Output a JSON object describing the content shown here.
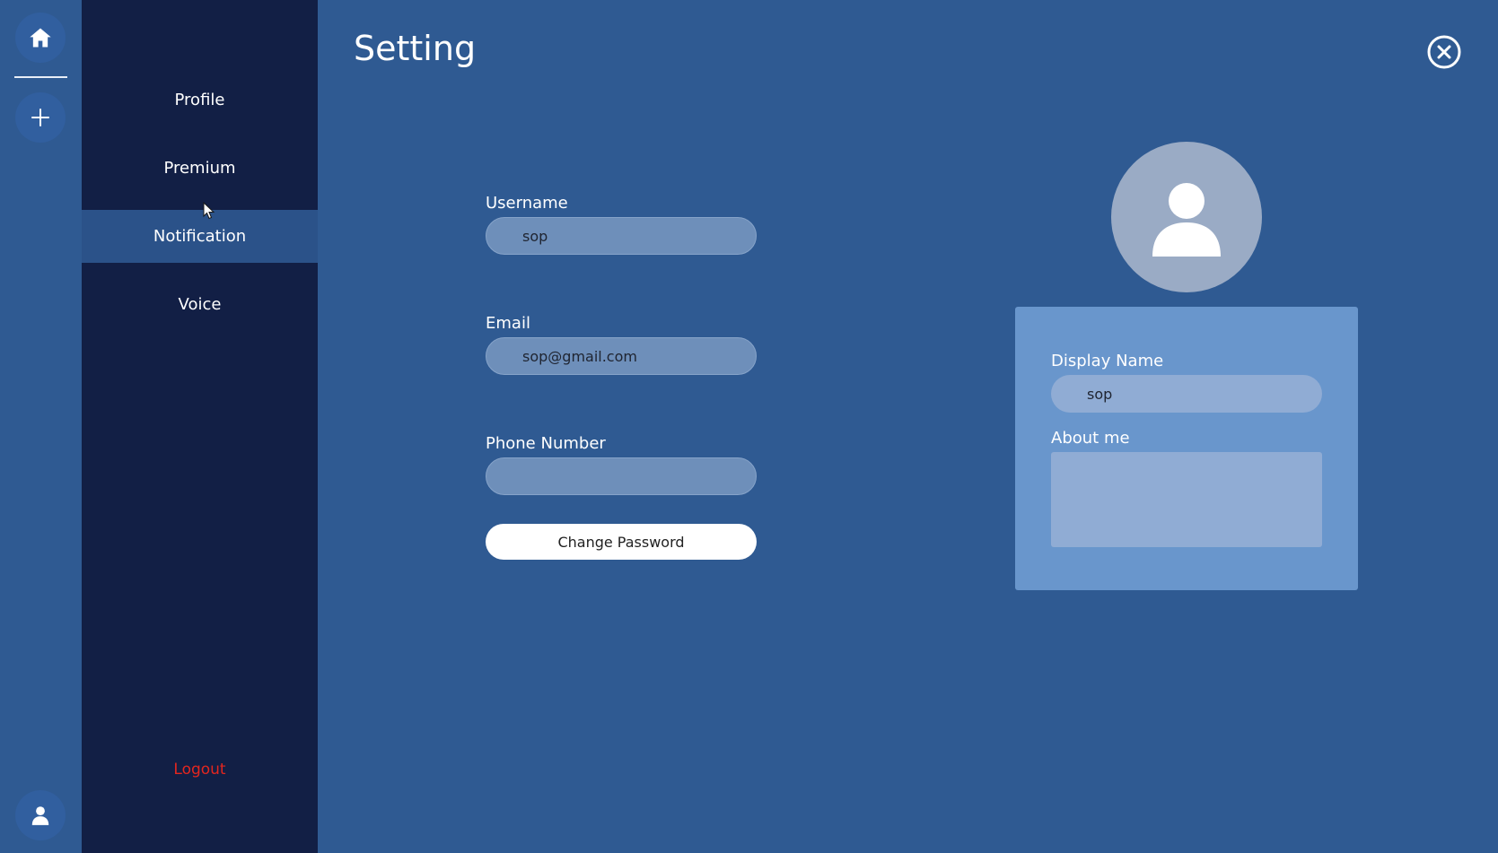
{
  "page": {
    "title": "Setting"
  },
  "rail": {
    "home_icon": "home-icon",
    "add_icon": "plus-icon",
    "user_icon": "user-icon"
  },
  "nav": {
    "items": [
      {
        "label": "Profile"
      },
      {
        "label": "Premium"
      },
      {
        "label": "Notification"
      },
      {
        "label": "Voice"
      }
    ],
    "active_index": 2,
    "logout_label": "Logout"
  },
  "form": {
    "username_label": "Username",
    "username_value": "sop",
    "email_label": "Email",
    "email_value": "sop@gmail.com",
    "phone_label": "Phone Number",
    "phone_value": "",
    "change_password_label": "Change Password"
  },
  "profile_card": {
    "display_name_label": "Display Name",
    "display_name_value": "sop",
    "about_label": "About me",
    "about_value": ""
  },
  "colors": {
    "background": "#2f5a92",
    "nav_bg": "#121f45",
    "nav_active": "#2b5289",
    "logout": "#e3261f",
    "card": "#6996cc",
    "input": "#6e8fba"
  }
}
